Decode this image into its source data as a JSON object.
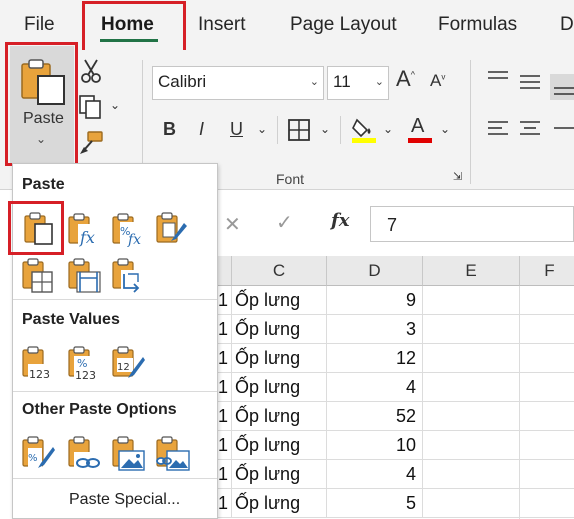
{
  "tabs": {
    "file": "File",
    "home": "Home",
    "insert": "Insert",
    "page_layout": "Page Layout",
    "formulas": "Formulas",
    "data_partial": "D"
  },
  "ribbon": {
    "paste_label": "Paste",
    "font_name": "Calibri",
    "font_size": "11",
    "bold": "B",
    "italic": "I",
    "underline": "U",
    "font_group_label": "Font",
    "grow_font": "A",
    "shrink_font": "A",
    "font_color_letter": "A",
    "highlight_color": "#ffff00",
    "font_color": "#e00000"
  },
  "formula_bar": {
    "fx": "fx",
    "value": "7"
  },
  "grid": {
    "columns": [
      "C",
      "D",
      "E",
      "F"
    ],
    "rows": [
      {
        "b": "1",
        "c": "Ốp lưng",
        "d": "9"
      },
      {
        "b": "1",
        "c": "Ốp lưng",
        "d": "3"
      },
      {
        "b": "1",
        "c": "Ốp lưng",
        "d": "12"
      },
      {
        "b": "1",
        "c": "Ốp lưng",
        "d": "4"
      },
      {
        "b": "1",
        "c": "Ốp lưng",
        "d": "52"
      },
      {
        "b": "1",
        "c": "Ốp lưng",
        "d": "10"
      },
      {
        "b": "1",
        "c": "Ốp lưng",
        "d": "4"
      },
      {
        "b": "1",
        "c": "Ốp lưng",
        "d": "5"
      }
    ]
  },
  "paste_menu": {
    "section_paste": "Paste",
    "section_values": "Paste Values",
    "section_other": "Other Paste Options",
    "paste_special": "Paste Special..."
  },
  "colors": {
    "accent_green": "#217346",
    "highlight_red": "#d61f26",
    "clipboard_orange": "#e8a33c",
    "icon_blue": "#2b6cb0"
  }
}
